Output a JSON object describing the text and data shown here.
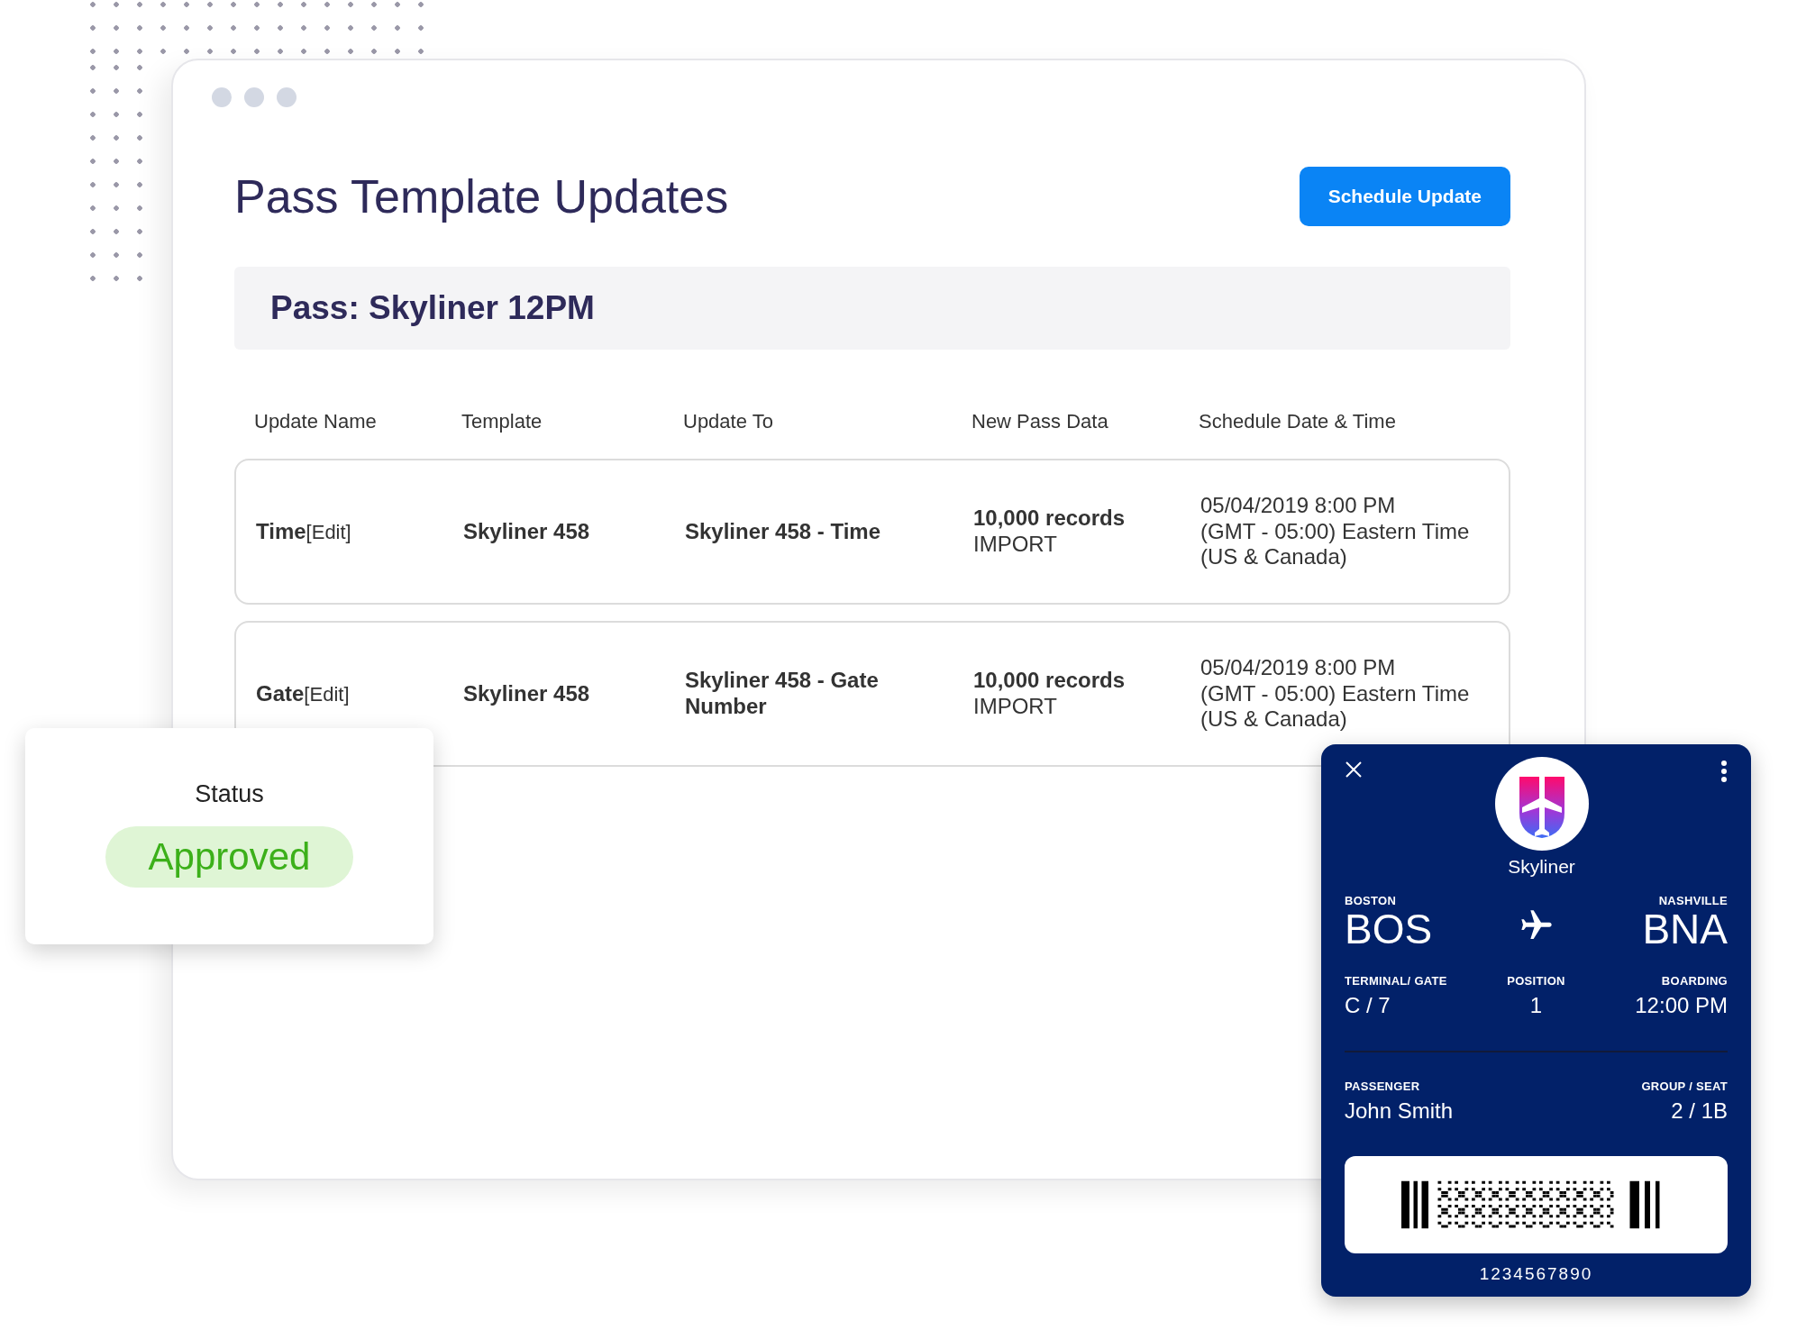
{
  "page": {
    "title": "Pass Template Updates",
    "action": "Schedule Update"
  },
  "pass_header": "Pass: Skyliner 12PM",
  "table": {
    "columns": [
      "Update Name",
      "Template",
      "Update To",
      "New Pass Data",
      "Schedule Date & Time"
    ],
    "rows": [
      {
        "name": "Time",
        "edit": "[Edit]",
        "template": "Skyliner 458",
        "update_to": "Skyliner 458 - Time",
        "records": "10,000 records",
        "source": "IMPORT",
        "schedule": [
          "05/04/2019 8:00 PM",
          "(GMT - 05:00) Eastern Time",
          "(US & Canada)"
        ]
      },
      {
        "name": "Gate",
        "edit": "[Edit]",
        "template": "Skyliner 458",
        "update_to": "Skyliner 458 - Gate Number",
        "records": "10,000 records",
        "source": "IMPORT",
        "schedule": [
          "05/04/2019 8:00 PM",
          "(GMT - 05:00) Eastern Time",
          "(US & Canada)"
        ]
      }
    ]
  },
  "status_card": {
    "label": "Status",
    "value": "Approved"
  },
  "pass_card": {
    "airline": "Skyliner",
    "origin": {
      "city": "BOSTON",
      "code": "BOS"
    },
    "destination": {
      "city": "NASHVILLE",
      "code": "BNA"
    },
    "fields": [
      {
        "label": "TERMINAL/ GATE",
        "value": "C / 7"
      },
      {
        "label": "POSITION",
        "value": "1"
      },
      {
        "label": "BOARDING",
        "value": "12:00 PM"
      }
    ],
    "passenger": {
      "label": "PASSENGER",
      "value": "John Smith"
    },
    "group_seat": {
      "label": "GROUP / SEAT",
      "value": "2 / 1B"
    },
    "barcode_number": "1234567890"
  }
}
